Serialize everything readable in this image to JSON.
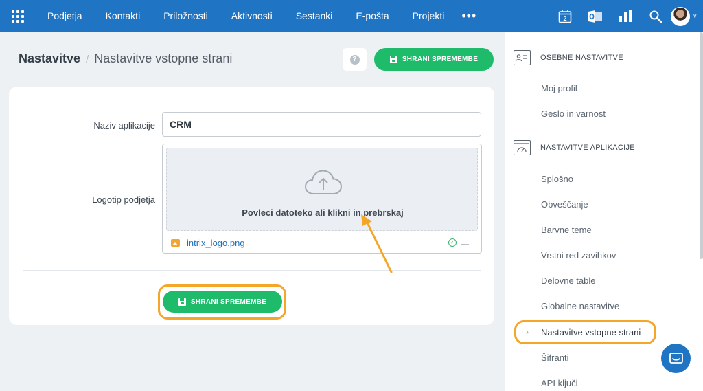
{
  "topbar": {
    "nav": [
      "Podjetja",
      "Kontakti",
      "Priložnosti",
      "Aktivnosti",
      "Sestanki",
      "E-pošta",
      "Projekti"
    ],
    "more": "•••",
    "calendar_day": "2",
    "icons": [
      "apps-grid-icon",
      "calendar-icon",
      "outlook-icon",
      "reports-icon",
      "search-icon",
      "avatar"
    ]
  },
  "header": {
    "breadcrumb_main": "Nastavitve",
    "breadcrumb_sep": "/",
    "breadcrumb_sub": "Nastavitve vstopne strani",
    "help": "?",
    "save_label": "SHRANI SPREMEMBE"
  },
  "form": {
    "app_name_label": "Naziv aplikacije",
    "app_name_value": "CRM",
    "logo_label": "Logotip podjetja",
    "drop_text": "Povleci datoteko ali klikni in prebrskaj",
    "file_name": "intrix_logo.png",
    "save_label": "SHRANI SPREMEMBE"
  },
  "sidebar": {
    "section1": "OSEBNE NASTAVITVE",
    "section1_items": [
      "Moj profil",
      "Geslo in varnost"
    ],
    "section2": "NASTAVITVE APLIKACIJE",
    "section2_items": [
      "Splošno",
      "Obveščanje",
      "Barvne teme",
      "Vrstni red zavihkov",
      "Delovne table",
      "Globalne nastavitve",
      "Nastavitve vstopne strani",
      "Šifranti",
      "API ključi"
    ],
    "active": "Nastavitve vstopne strani"
  },
  "colors": {
    "topbar": "#1f74c4",
    "primary_button": "#1dbb6a",
    "highlight": "#f4a628"
  }
}
